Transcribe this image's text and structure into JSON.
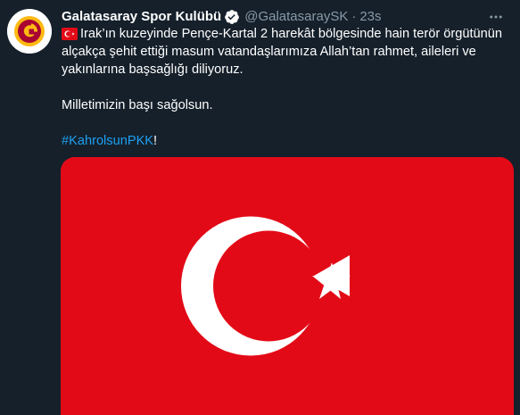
{
  "tweet": {
    "display_name": "Galatasaray Spor Kulübü",
    "handle": "@GalatasaraySK",
    "separator": "·",
    "timestamp": "23s",
    "text_line1": "Irak’ın kuzeyinde Pençe-Kartal 2 harekât bölgesinde hain terör örgütünün alçakça şehit ettiği masum vatandaşlarımıza Allah’tan rahmet, aileleri ve yakınlarına başsağlığı diliyoruz.",
    "text_line2": "Milletimizin başı sağolsun.",
    "hashtag": "#KahrolsunPKK",
    "hashtag_suffix": "!"
  },
  "colors": {
    "background": "#15202b",
    "text": "#ffffff",
    "muted": "#8899a6",
    "link": "#1da1f2",
    "flag_red": "#e30a17",
    "flag_white": "#ffffff",
    "galatasaray_yellow": "#fdb912",
    "galatasaray_red": "#a90432"
  },
  "icons": {
    "avatar": "galatasaray-logo",
    "verified": "verified-badge-icon",
    "more": "more-options-icon",
    "flag_emoji": "turkey-flag-icon",
    "media": "turkey-flag-image"
  }
}
